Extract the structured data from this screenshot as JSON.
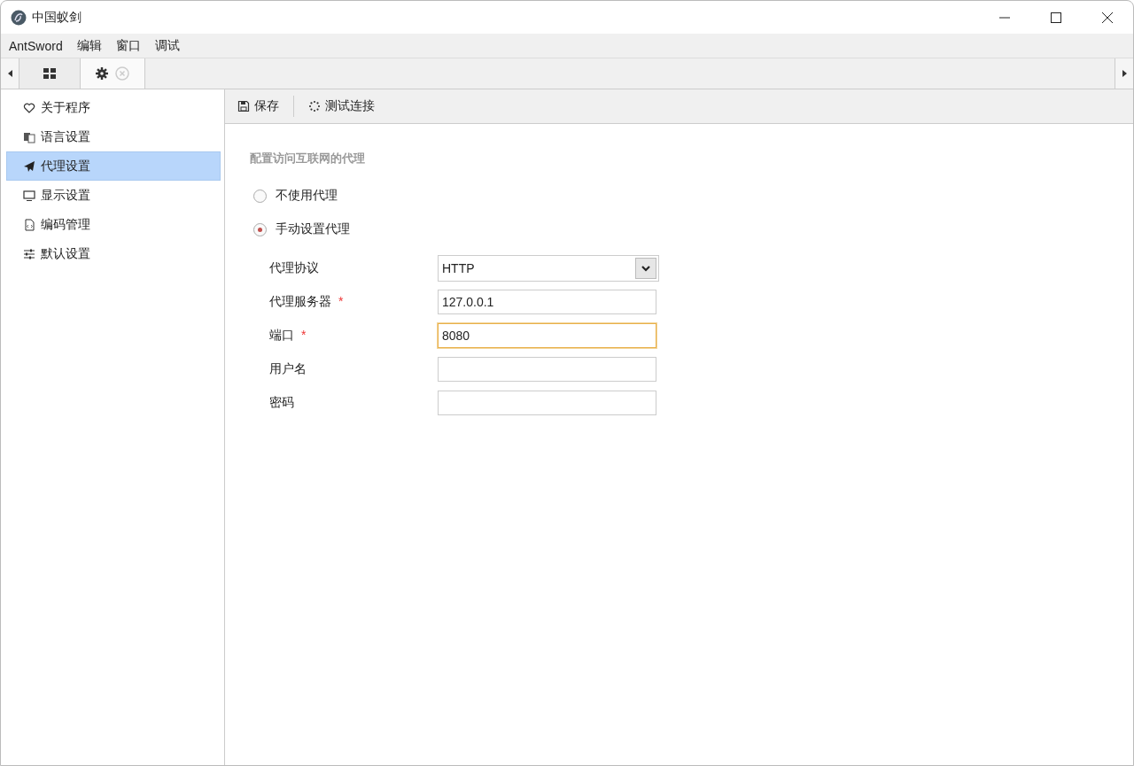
{
  "window": {
    "title": "中国蚁剑"
  },
  "menu": [
    "AntSword",
    "编辑",
    "窗口",
    "调试"
  ],
  "sidebar": {
    "items": [
      {
        "label": "关于程序",
        "kind": "heart",
        "selected": false
      },
      {
        "label": "语言设置",
        "kind": "language",
        "selected": false
      },
      {
        "label": "代理设置",
        "kind": "plane",
        "selected": true
      },
      {
        "label": "显示设置",
        "kind": "monitor",
        "selected": false
      },
      {
        "label": "编码管理",
        "kind": "code",
        "selected": false
      },
      {
        "label": "默认设置",
        "kind": "sliders",
        "selected": false
      }
    ]
  },
  "toolbar": {
    "buttons": [
      {
        "label": "保存",
        "kind": "save"
      },
      {
        "label": "测试连接",
        "kind": "spinner"
      }
    ]
  },
  "proxy": {
    "heading": "配置访问互联网的代理",
    "options": [
      {
        "label": "不使用代理",
        "selected": false
      },
      {
        "label": "手动设置代理",
        "selected": true
      }
    ],
    "fields": [
      {
        "label": "代理协议",
        "kind": "select",
        "value": "HTTP"
      },
      {
        "label": "代理服务器",
        "kind": "text",
        "required_mark": "*",
        "value": "127.0.0.1"
      },
      {
        "label": "端口",
        "kind": "text",
        "required_mark": "*",
        "value": "8080",
        "focused": true
      },
      {
        "label": "用户名",
        "kind": "text"
      },
      {
        "label": "密码",
        "kind": "text"
      }
    ]
  }
}
